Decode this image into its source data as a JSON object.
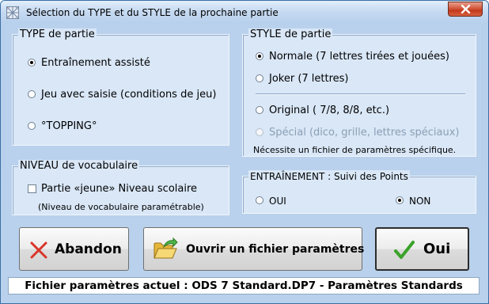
{
  "window": {
    "title": "Sélection du TYPE et du STYLE de la prochaine partie"
  },
  "type_group": {
    "title": "TYPE de partie",
    "options": [
      {
        "label": "Entraînement assisté",
        "selected": true
      },
      {
        "label": "Jeu avec saisie (conditions de jeu)",
        "selected": false
      },
      {
        "label": "°TOPPING°",
        "selected": false
      }
    ]
  },
  "niveau_group": {
    "title": "NIVEAU de vocabulaire",
    "checkbox_label": "Partie «jeune» Niveau scolaire",
    "checkbox_checked": false,
    "note": "(Niveau de vocabulaire paramétrable)"
  },
  "style_group": {
    "title": "STYLE de partie",
    "options": [
      {
        "label": "Normale (7 lettres tirées et jouées)",
        "selected": true,
        "enabled": true
      },
      {
        "label": "Joker (7 lettres)",
        "selected": false,
        "enabled": true
      },
      {
        "label": "Original ( 7/8, 8/8, etc.)",
        "selected": false,
        "enabled": true
      },
      {
        "label": "Spécial (dico, grille, lettres spéciaux)",
        "selected": false,
        "enabled": false
      }
    ],
    "note": "Nécessite un fichier de paramètres spécifique."
  },
  "entrainement_group": {
    "title": "ENTRAÎNEMENT : Suivi des Points",
    "options": [
      {
        "label": "OUI",
        "selected": false
      },
      {
        "label": "NON",
        "selected": true
      }
    ]
  },
  "buttons": {
    "cancel": "Abandon",
    "open_params": "Ouvrir un fichier paramètres",
    "ok": "Oui"
  },
  "status": "Fichier paramètres actuel : ODS 7 Standard.DP7 - Paramètres Standards",
  "colors": {
    "cancel_icon": "#d9342a",
    "ok_icon": "#3aa32a",
    "folder_icon": "#f1c84a"
  }
}
